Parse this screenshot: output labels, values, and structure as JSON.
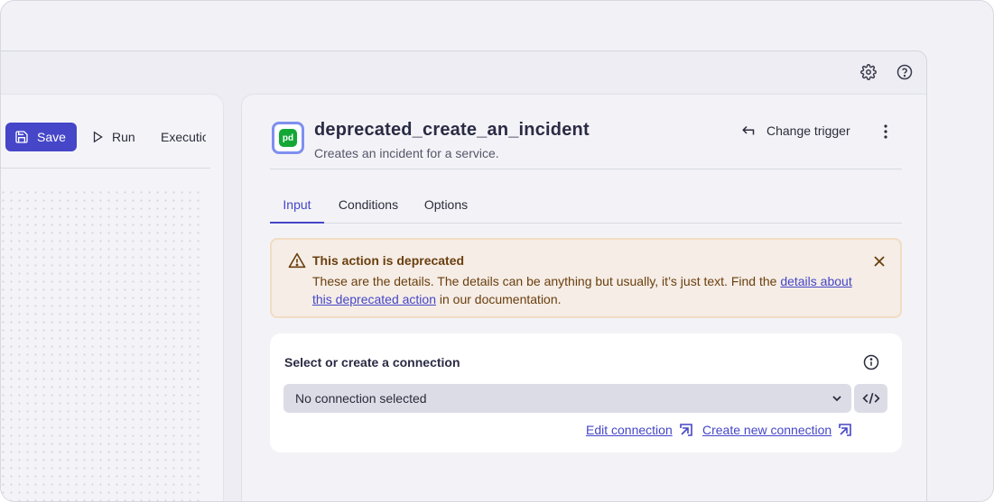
{
  "toolbar": {
    "save_label": "Save",
    "run_label": "Run",
    "executions_label": "Executions"
  },
  "action": {
    "title": "deprecated_create_an_incident",
    "subtitle": "Creates an incident for a service.",
    "logo_text": "pd",
    "change_trigger_label": "Change trigger"
  },
  "tabs": [
    {
      "label": "Input",
      "active": true
    },
    {
      "label": "Conditions",
      "active": false
    },
    {
      "label": "Options",
      "active": false
    }
  ],
  "alert": {
    "title": "This action is deprecated",
    "body_before": "These are the details. The details can be anything but usually, it’s just text. Find the ",
    "link_text": "details about this deprecated action",
    "body_after": " in our documentation."
  },
  "connection": {
    "label": "Select or create a connection",
    "selected_value": "No connection selected",
    "edit_label": "Edit connection",
    "create_label": "Create new connection"
  },
  "colors": {
    "accent": "#4546c8",
    "alert_background": "#f5ede6",
    "alert_text": "#6b3e0d",
    "logo_green": "#13a836"
  }
}
